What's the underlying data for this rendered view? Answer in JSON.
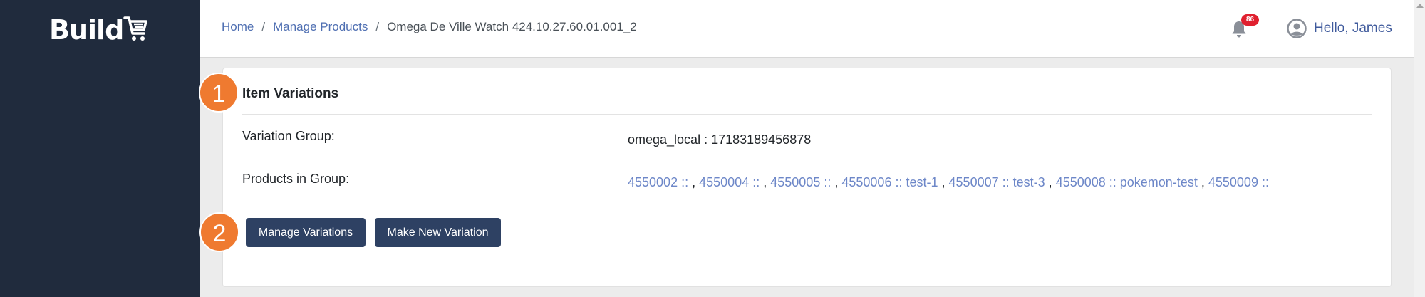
{
  "brand": {
    "name": "Build"
  },
  "breadcrumb": {
    "items": [
      {
        "label": "Home"
      },
      {
        "label": "Manage Products"
      },
      {
        "label": "Omega De Ville Watch 424.10.27.60.01.001_2"
      }
    ],
    "separator": "/"
  },
  "header": {
    "notifications_count": "86",
    "greeting": "Hello, James"
  },
  "card": {
    "title": "Item Variations",
    "variation_group_label": "Variation Group:",
    "variation_group_value": "omega_local : 17183189456878",
    "products_label": "Products in Group:",
    "products": [
      "4550002 ::",
      "4550004 ::",
      "4550005 ::",
      "4550006 :: test-1",
      "4550007 :: test-3",
      "4550008 :: pokemon-test",
      "4550009 ::"
    ],
    "product_separator": ",",
    "manage_button": "Manage Variations",
    "new_button": "Make New Variation"
  },
  "steps": [
    "1",
    "2"
  ],
  "colors": {
    "sidebar": "#202b3d",
    "button": "#2e4163",
    "link": "#6d87c8",
    "step_marker": "#ef7a30",
    "badge": "#e0202f"
  }
}
